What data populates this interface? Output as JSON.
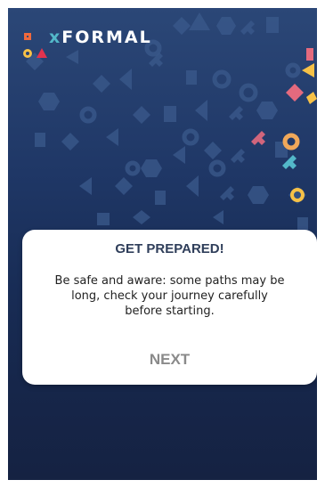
{
  "app": {
    "logo_x": "x",
    "logo_word": "FORMAL"
  },
  "dialog": {
    "title": "GET PREPARED!",
    "message": "Be safe and aware: some paths may be long, check your journey carefully before starting.",
    "next_label": "NEXT"
  },
  "colors": {
    "background": "#1f3766",
    "accent_teal": "#53b8c9",
    "accent_orange": "#f0693c",
    "accent_yellow": "#f6c147",
    "accent_red": "#e2334e",
    "button_text": "#8a8a8a"
  },
  "icons": {
    "logo_square": "square-icon",
    "logo_circle": "circle-icon",
    "logo_triangle": "triangle-icon"
  }
}
